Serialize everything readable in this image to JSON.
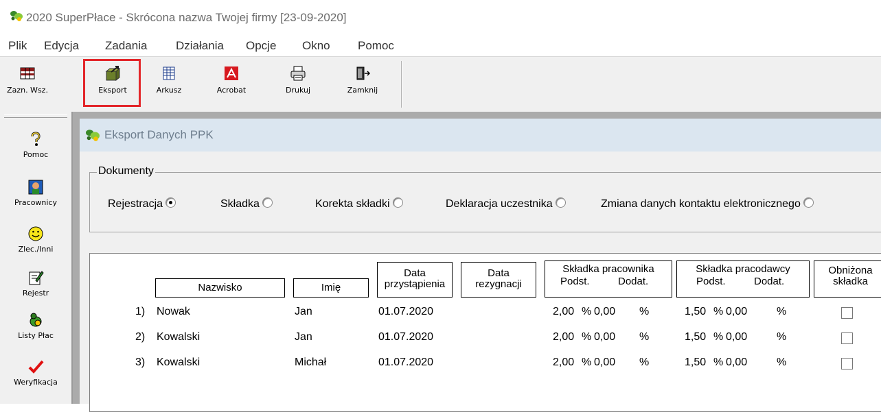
{
  "window": {
    "title": "2020 SuperPłace - Skrócona nazwa Twojej firmy [23-09-2020]"
  },
  "menu": [
    "Plik",
    "Edycja",
    "Zadania",
    "Działania",
    "Opcje",
    "Okno",
    "Pomoc"
  ],
  "toolbar": [
    {
      "label": "Zazn. Wsz.",
      "icon": "select-all-icon"
    },
    {
      "label": "Eksport",
      "icon": "export-icon"
    },
    {
      "label": "Arkusz",
      "icon": "spreadsheet-icon"
    },
    {
      "label": "Acrobat",
      "icon": "acrobat-icon"
    },
    {
      "label": "Drukuj",
      "icon": "printer-icon"
    },
    {
      "label": "Zamknij",
      "icon": "close-door-icon"
    }
  ],
  "sidebar": [
    {
      "label": "Pomoc",
      "icon": "help-icon"
    },
    {
      "label": "Pracownicy",
      "icon": "employees-icon"
    },
    {
      "label": "Zlec./Inni",
      "icon": "smiley-icon"
    },
    {
      "label": "Rejestr",
      "icon": "register-icon"
    },
    {
      "label": "Listy Płac",
      "icon": "payroll-icon"
    },
    {
      "label": "Weryfikacja",
      "icon": "checkmark-icon"
    }
  ],
  "child_window": {
    "title": "Eksport Danych PPK"
  },
  "documents": {
    "legend": "Dokumenty",
    "options": [
      {
        "label": "Rejestracja",
        "checked": true
      },
      {
        "label": "Składka",
        "checked": false
      },
      {
        "label": "Korekta składki",
        "checked": false
      },
      {
        "label": "Deklaracja uczestnika",
        "checked": false
      },
      {
        "label": "Zmiana danych kontaktu elektronicznego",
        "checked": false
      }
    ]
  },
  "table": {
    "headers": {
      "nazwisko": "Nazwisko",
      "imie": "Imię",
      "data_przyst_1": "Data",
      "data_przyst_2": "przystąpienia",
      "data_rez_1": "Data",
      "data_rez_2": "rezygnacji",
      "skl_prac": "Składka pracownika",
      "skl_pracod": "Składka pracodawcy",
      "podst": "Podst.",
      "dodat": "Dodat.",
      "obniz_1": "Obniżona",
      "obniz_2": "składka",
      "percent": "%"
    },
    "rows": [
      {
        "no": "1)",
        "nazwisko": "Nowak",
        "imie": "Jan",
        "data": "01.07.2020",
        "rez": "",
        "p_podst": "2,00",
        "p_dodat": "0,00",
        "e_podst": "1,50",
        "e_dodat": "0,00",
        "reduced": false
      },
      {
        "no": "2)",
        "nazwisko": "Kowalski",
        "imie": "Jan",
        "data": "01.07.2020",
        "rez": "",
        "p_podst": "2,00",
        "p_dodat": "0,00",
        "e_podst": "1,50",
        "e_dodat": "0,00",
        "reduced": false
      },
      {
        "no": "3)",
        "nazwisko": "Kowalski",
        "imie": "Michał",
        "data": "01.07.2020",
        "rez": "",
        "p_podst": "2,00",
        "p_dodat": "0,00",
        "e_podst": "1,50",
        "e_dodat": "0,00",
        "reduced": false
      }
    ]
  },
  "colors": {
    "highlight": "#e3262a",
    "child_title_bg": "#dbe6f0",
    "mdi_bg": "#ababab"
  }
}
